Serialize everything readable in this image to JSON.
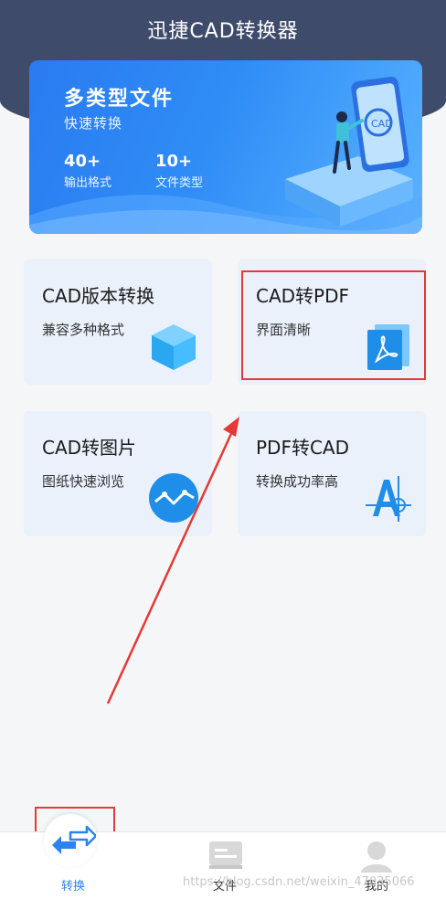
{
  "app": {
    "title": "迅捷CAD转换器"
  },
  "banner": {
    "title": "多类型文件",
    "subtitle": "快速转换",
    "stats": [
      {
        "num": "40+",
        "label": "输出格式"
      },
      {
        "num": "10+",
        "label": "文件类型"
      }
    ]
  },
  "cards": [
    {
      "title": "CAD版本转换",
      "subtitle": "兼容多种格式",
      "icon": "cube-icon"
    },
    {
      "title": "CAD转PDF",
      "subtitle": "界面清晰",
      "icon": "pdf-icon"
    },
    {
      "title": "CAD转图片",
      "subtitle": "图纸快速浏览",
      "icon": "image-chart-icon"
    },
    {
      "title": "PDF转CAD",
      "subtitle": "转换成功率高",
      "icon": "cad-drawing-icon"
    }
  ],
  "nav": {
    "items": [
      {
        "label": "转换",
        "icon": "convert-arrows-icon",
        "active": true
      },
      {
        "label": "文件",
        "icon": "folder-icon",
        "active": false
      },
      {
        "label": "我的",
        "icon": "user-icon",
        "active": false
      }
    ]
  },
  "watermark": "https://blog.csdn.net/weixin_47035066",
  "colors": {
    "header": "#3f4b6b",
    "accent": "#2a83f0",
    "card": "#eaf1fb",
    "annotation": "#e53935"
  }
}
